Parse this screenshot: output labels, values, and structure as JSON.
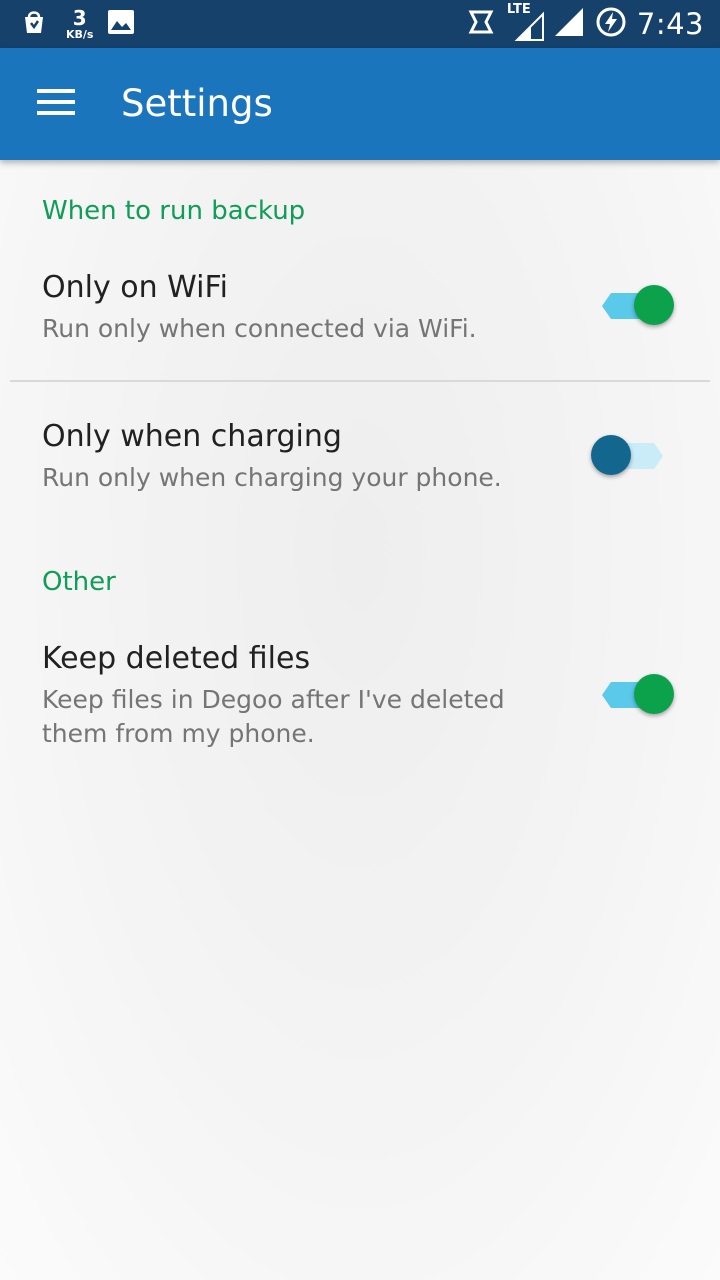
{
  "status_bar": {
    "speed_value": "3",
    "speed_unit": "KB/s",
    "network": "LTE",
    "time": "7:43",
    "icons": [
      "store-icon",
      "image-icon",
      "rotate-icon",
      "lte-signal-icon",
      "signal-icon",
      "battery-charging-icon"
    ]
  },
  "app_bar": {
    "menu_icon": "hamburger-menu-icon",
    "title": "Settings",
    "color": "#1b75bc"
  },
  "sections": [
    {
      "header": "When to run backup",
      "items": [
        {
          "title": "Only on WiFi",
          "summary": "Run only when connected via WiFi.",
          "enabled": true
        },
        {
          "title": "Only when charging",
          "summary": "Run only when charging your phone.",
          "enabled": false
        }
      ]
    },
    {
      "header": "Other",
      "items": [
        {
          "title": "Keep deleted files",
          "summary": "Keep files in Degoo after I've deleted them from my phone.",
          "enabled": true
        }
      ]
    }
  ],
  "colors": {
    "status_bar": "#15416b",
    "accent_green": "#0f9d58",
    "switch_on_thumb": "#0ca24c",
    "switch_on_track": "#5bc9ea",
    "switch_off_thumb": "#13678f",
    "switch_off_track": "#c9ecf8"
  }
}
